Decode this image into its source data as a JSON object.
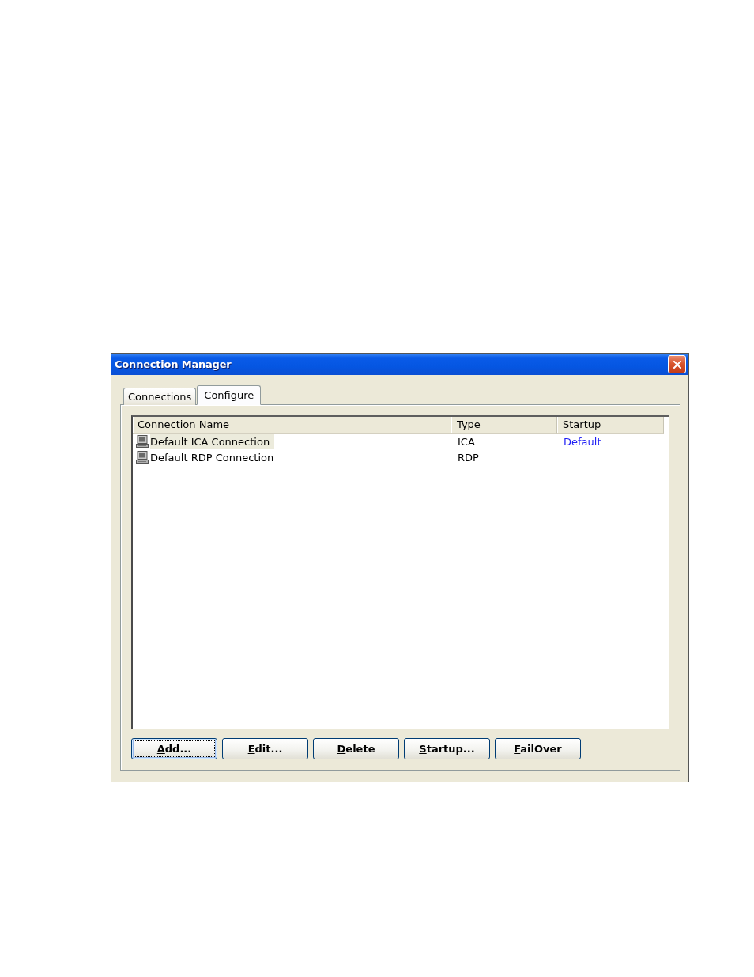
{
  "window": {
    "title": "Connection Manager"
  },
  "tabs": [
    {
      "label": "Connections",
      "selected": false
    },
    {
      "label": "Configure",
      "selected": true
    }
  ],
  "table": {
    "columns": [
      "Connection Name",
      "Type",
      "Startup"
    ],
    "rows": [
      {
        "name": "Default ICA Connection",
        "type": "ICA",
        "startup": "Default",
        "selected": true
      },
      {
        "name": "Default RDP Connection",
        "type": "RDP",
        "selected": false
      }
    ]
  },
  "buttons": [
    {
      "mnemonic": "A",
      "rest": "dd...",
      "focused": true
    },
    {
      "mnemonic": "E",
      "rest": "dit...",
      "focused": false
    },
    {
      "mnemonic": "D",
      "rest": "elete",
      "focused": false
    },
    {
      "mnemonic": "S",
      "rest": "tartup...",
      "focused": false
    },
    {
      "mnemonic": "F",
      "rest": "ailOver",
      "focused": false
    }
  ]
}
